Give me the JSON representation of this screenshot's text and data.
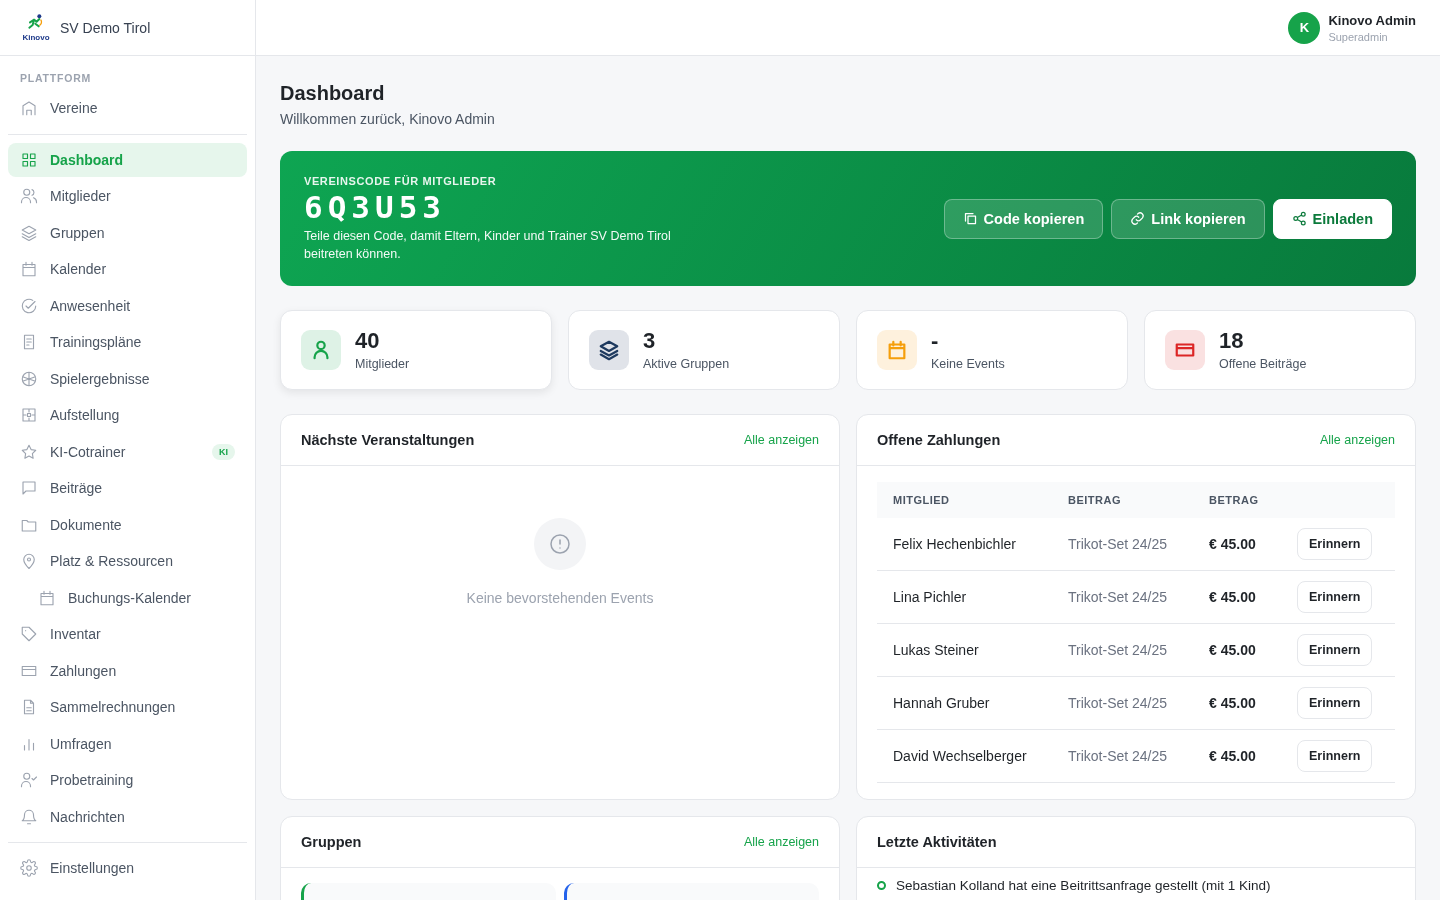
{
  "sidebar": {
    "club_name": "SV Demo Tirol",
    "logo_text": "Kinovo",
    "section_label": "PLATTFORM",
    "top_items": [
      {
        "label": "Vereine",
        "selected": false
      }
    ],
    "items": [
      {
        "label": "Dashboard",
        "selected": true
      },
      {
        "label": "Mitglieder",
        "selected": false
      },
      {
        "label": "Gruppen",
        "selected": false
      },
      {
        "label": "Kalender",
        "selected": false
      },
      {
        "label": "Anwesenheit",
        "selected": false
      },
      {
        "label": "Trainingspläne",
        "selected": false
      },
      {
        "label": "Spielergebnisse",
        "selected": false
      },
      {
        "label": "Aufstellung",
        "selected": false
      },
      {
        "label": "KI-Cotrainer",
        "selected": false,
        "badge": "KI"
      },
      {
        "label": "Beiträge",
        "selected": false
      },
      {
        "label": "Dokumente",
        "selected": false
      },
      {
        "label": "Platz & Ressourcen",
        "selected": false,
        "children": [
          {
            "label": "Buchungs-Kalender",
            "selected": false
          }
        ]
      },
      {
        "label": "Inventar",
        "selected": false
      },
      {
        "label": "Zahlungen",
        "selected": false
      },
      {
        "label": "Sammelrechnungen",
        "selected": false
      },
      {
        "label": "Umfragen",
        "selected": false
      },
      {
        "label": "Probetraining",
        "selected": false
      },
      {
        "label": "Nachrichten",
        "selected": false
      }
    ],
    "bottom_items": [
      {
        "label": "Einstellungen",
        "selected": false
      }
    ]
  },
  "user": {
    "initial": "K",
    "name": "Kinovo Admin",
    "role": "Superadmin"
  },
  "page": {
    "title": "Dashboard",
    "subtitle": "Willkommen zurück, Kinovo Admin"
  },
  "banner": {
    "label": "VEREINSCODE FÜR MITGLIEDER",
    "code": "6Q3U53",
    "description": "Teile diesen Code, damit Eltern, Kinder und Trainer SV Demo Tirol beitreten können.",
    "buttons": [
      {
        "label": "Code kopieren",
        "kind": "ghost"
      },
      {
        "label": "Link kopieren",
        "kind": "ghost"
      },
      {
        "label": "Einladen",
        "kind": "primary"
      }
    ]
  },
  "stats": [
    {
      "value": "40",
      "label": "Mitglieder",
      "color": "#16a34a"
    },
    {
      "value": "3",
      "label": "Aktive Gruppen",
      "color": "#1e3a5f"
    },
    {
      "value": "-",
      "label": "Keine Events",
      "color": "#f59e0b"
    },
    {
      "value": "18",
      "label": "Offene Beiträge",
      "color": "#dc2626"
    }
  ],
  "events": {
    "title": "Nächste Veranstaltungen",
    "link": "Alle anzeigen",
    "empty": "Keine bevorstehenden Events"
  },
  "payments": {
    "title": "Offene Zahlungen",
    "link": "Alle anzeigen",
    "columns": [
      "MITGLIED",
      "BEITRAG",
      "BETRAG"
    ],
    "rows": [
      {
        "member": "Felix Hechenbichler",
        "fee": "Trikot-Set 24/25",
        "amount": "€ 45.00",
        "action": "Erinnern"
      },
      {
        "member": "Lina Pichler",
        "fee": "Trikot-Set 24/25",
        "amount": "€ 45.00",
        "action": "Erinnern"
      },
      {
        "member": "Lukas Steiner",
        "fee": "Trikot-Set 24/25",
        "amount": "€ 45.00",
        "action": "Erinnern"
      },
      {
        "member": "Hannah Gruber",
        "fee": "Trikot-Set 24/25",
        "amount": "€ 45.00",
        "action": "Erinnern"
      },
      {
        "member": "David Wechselberger",
        "fee": "Trikot-Set 24/25",
        "amount": "€ 45.00",
        "action": "Erinnern"
      }
    ]
  },
  "groups": {
    "title": "Gruppen",
    "link": "Alle anzeigen",
    "cards": [
      {
        "color": "#16a34a"
      },
      {
        "color": "#2563eb"
      }
    ]
  },
  "activity": {
    "title": "Letzte Aktivitäten",
    "items": [
      {
        "text": "Sebastian Kolland hat eine Beitrittsanfrage gestellt (mit 1 Kind)",
        "color": "#16a34a"
      }
    ]
  }
}
